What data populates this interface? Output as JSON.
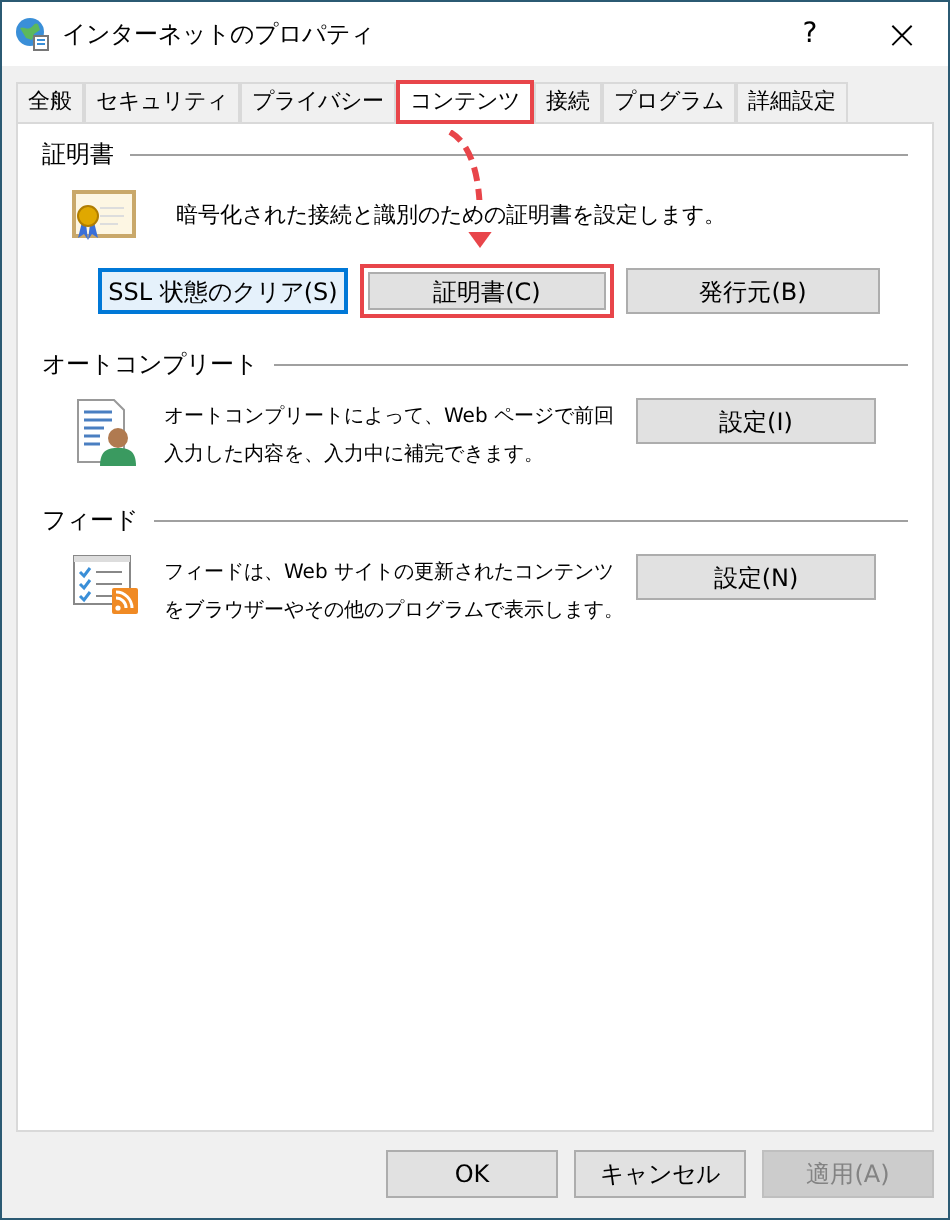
{
  "window": {
    "title": "インターネットのプロパティ",
    "help": "?",
    "close": "×"
  },
  "tabs": [
    {
      "label": "全般",
      "selected": false,
      "highlighted": false
    },
    {
      "label": "セキュリティ",
      "selected": false,
      "highlighted": false
    },
    {
      "label": "プライバシー",
      "selected": false,
      "highlighted": false
    },
    {
      "label": "コンテンツ",
      "selected": true,
      "highlighted": true
    },
    {
      "label": "接続",
      "selected": false,
      "highlighted": false
    },
    {
      "label": "プログラム",
      "selected": false,
      "highlighted": false
    },
    {
      "label": "詳細設定",
      "selected": false,
      "highlighted": false
    }
  ],
  "sections": [
    {
      "kind": "certificate",
      "title": "証明書",
      "description": "暗号化された接続と識別のための証明書を設定します。",
      "buttons": [
        {
          "label": "SSL 状態のクリア(S)",
          "focused": true,
          "highlighted": false
        },
        {
          "label": "証明書(C)",
          "focused": false,
          "highlighted": true
        },
        {
          "label": "発行元(B)",
          "focused": false,
          "highlighted": false
        }
      ]
    },
    {
      "kind": "autocomplete",
      "title": "オートコンプリート",
      "description": "オートコンプリートによって、Web ページで前回入力した内容を、入力中に補完できます。",
      "buttons": [
        {
          "label": "設定(I)",
          "focused": false,
          "highlighted": false
        }
      ]
    },
    {
      "kind": "feeds",
      "title": "フィード",
      "description": "フィードは、Web サイトの更新されたコンテンツをブラウザーやその他のプログラムで表示します。",
      "buttons": [
        {
          "label": "設定(N)",
          "focused": false,
          "highlighted": false
        }
      ]
    }
  ],
  "annotation_arrow": true,
  "footer_buttons": [
    {
      "label": "OK",
      "disabled": false
    },
    {
      "label": "キャンセル",
      "disabled": false
    },
    {
      "label": "適用(A)",
      "disabled": true
    }
  ]
}
